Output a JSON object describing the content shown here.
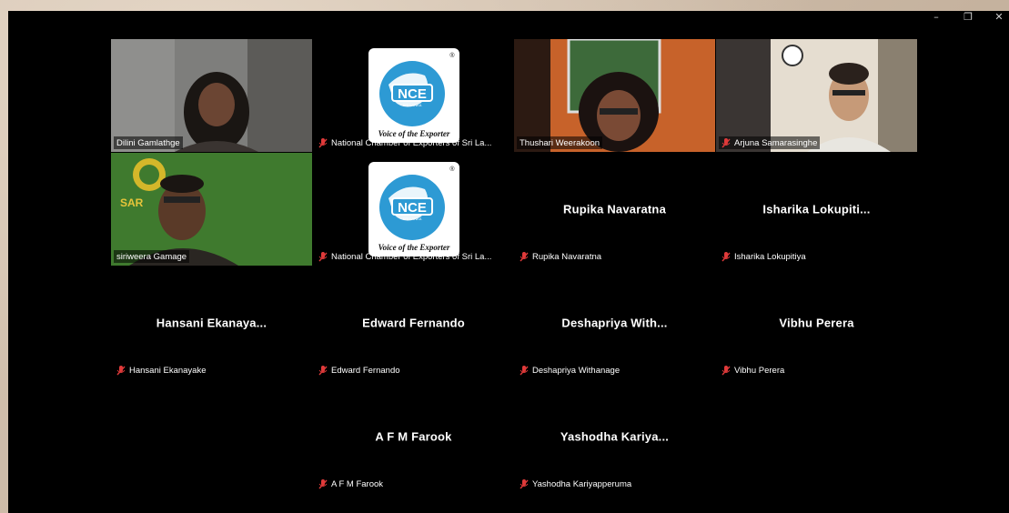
{
  "window_controls": {
    "minimize": "–",
    "restore": "❐",
    "close": "✕"
  },
  "logo": {
    "text": "NCE",
    "sub": "SRI LANKA",
    "motto": "Voice of the Exporter",
    "registered": "®"
  },
  "tiles": [
    {
      "label": "Dilini Gamlathge"
    },
    {
      "label": "National Chamber of Exporters of Sri La..."
    },
    {
      "label": "Thushari Weerakoon"
    },
    {
      "label": "Arjuna Samarasinghe"
    },
    {
      "label": "siriweera Gamage",
      "bg_text": "SAR"
    },
    {
      "label": "National Chamber of Exporters of Sri La..."
    },
    {
      "name": "Rupika Navaratna",
      "label": "Rupika Navaratna"
    },
    {
      "name": "Isharika  Lokupiti...",
      "label": "Isharika Lokupitiya"
    },
    {
      "name": "Hansani  Ekanaya...",
      "label": "Hansani Ekanayake"
    },
    {
      "name": "Edward Fernando",
      "label": "Edward Fernando"
    },
    {
      "name": "Deshapriya  With...",
      "label": "Deshapriya Withanage"
    },
    {
      "name": "Vibhu Perera",
      "label": "Vibhu Perera"
    },
    {
      "name": "A F M Farook",
      "label": "A F M Farook"
    },
    {
      "name": "Yashodha  Kariya...",
      "label": "Yashodha Kariyapperuma"
    }
  ]
}
